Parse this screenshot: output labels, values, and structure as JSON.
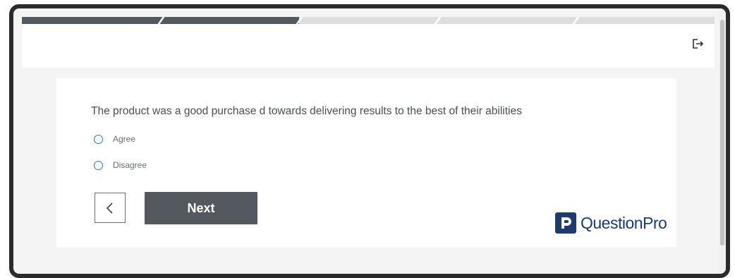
{
  "progress": {
    "completed_segments": 2,
    "total_segments": 5
  },
  "header": {
    "exit_icon": "exit-icon"
  },
  "question": {
    "text": "The product was a good purchase   d towards delivering results to the best of their abilities"
  },
  "options": [
    {
      "label": "Agree"
    },
    {
      "label": "Disagree"
    }
  ],
  "navigation": {
    "back_icon": "chevron-left-icon",
    "next_label": "Next"
  },
  "branding": {
    "logo_text": "QuestionPro",
    "logo_color": "#1e3a6e"
  },
  "colors": {
    "accent": "#2b78c2",
    "button": "#54595f"
  }
}
